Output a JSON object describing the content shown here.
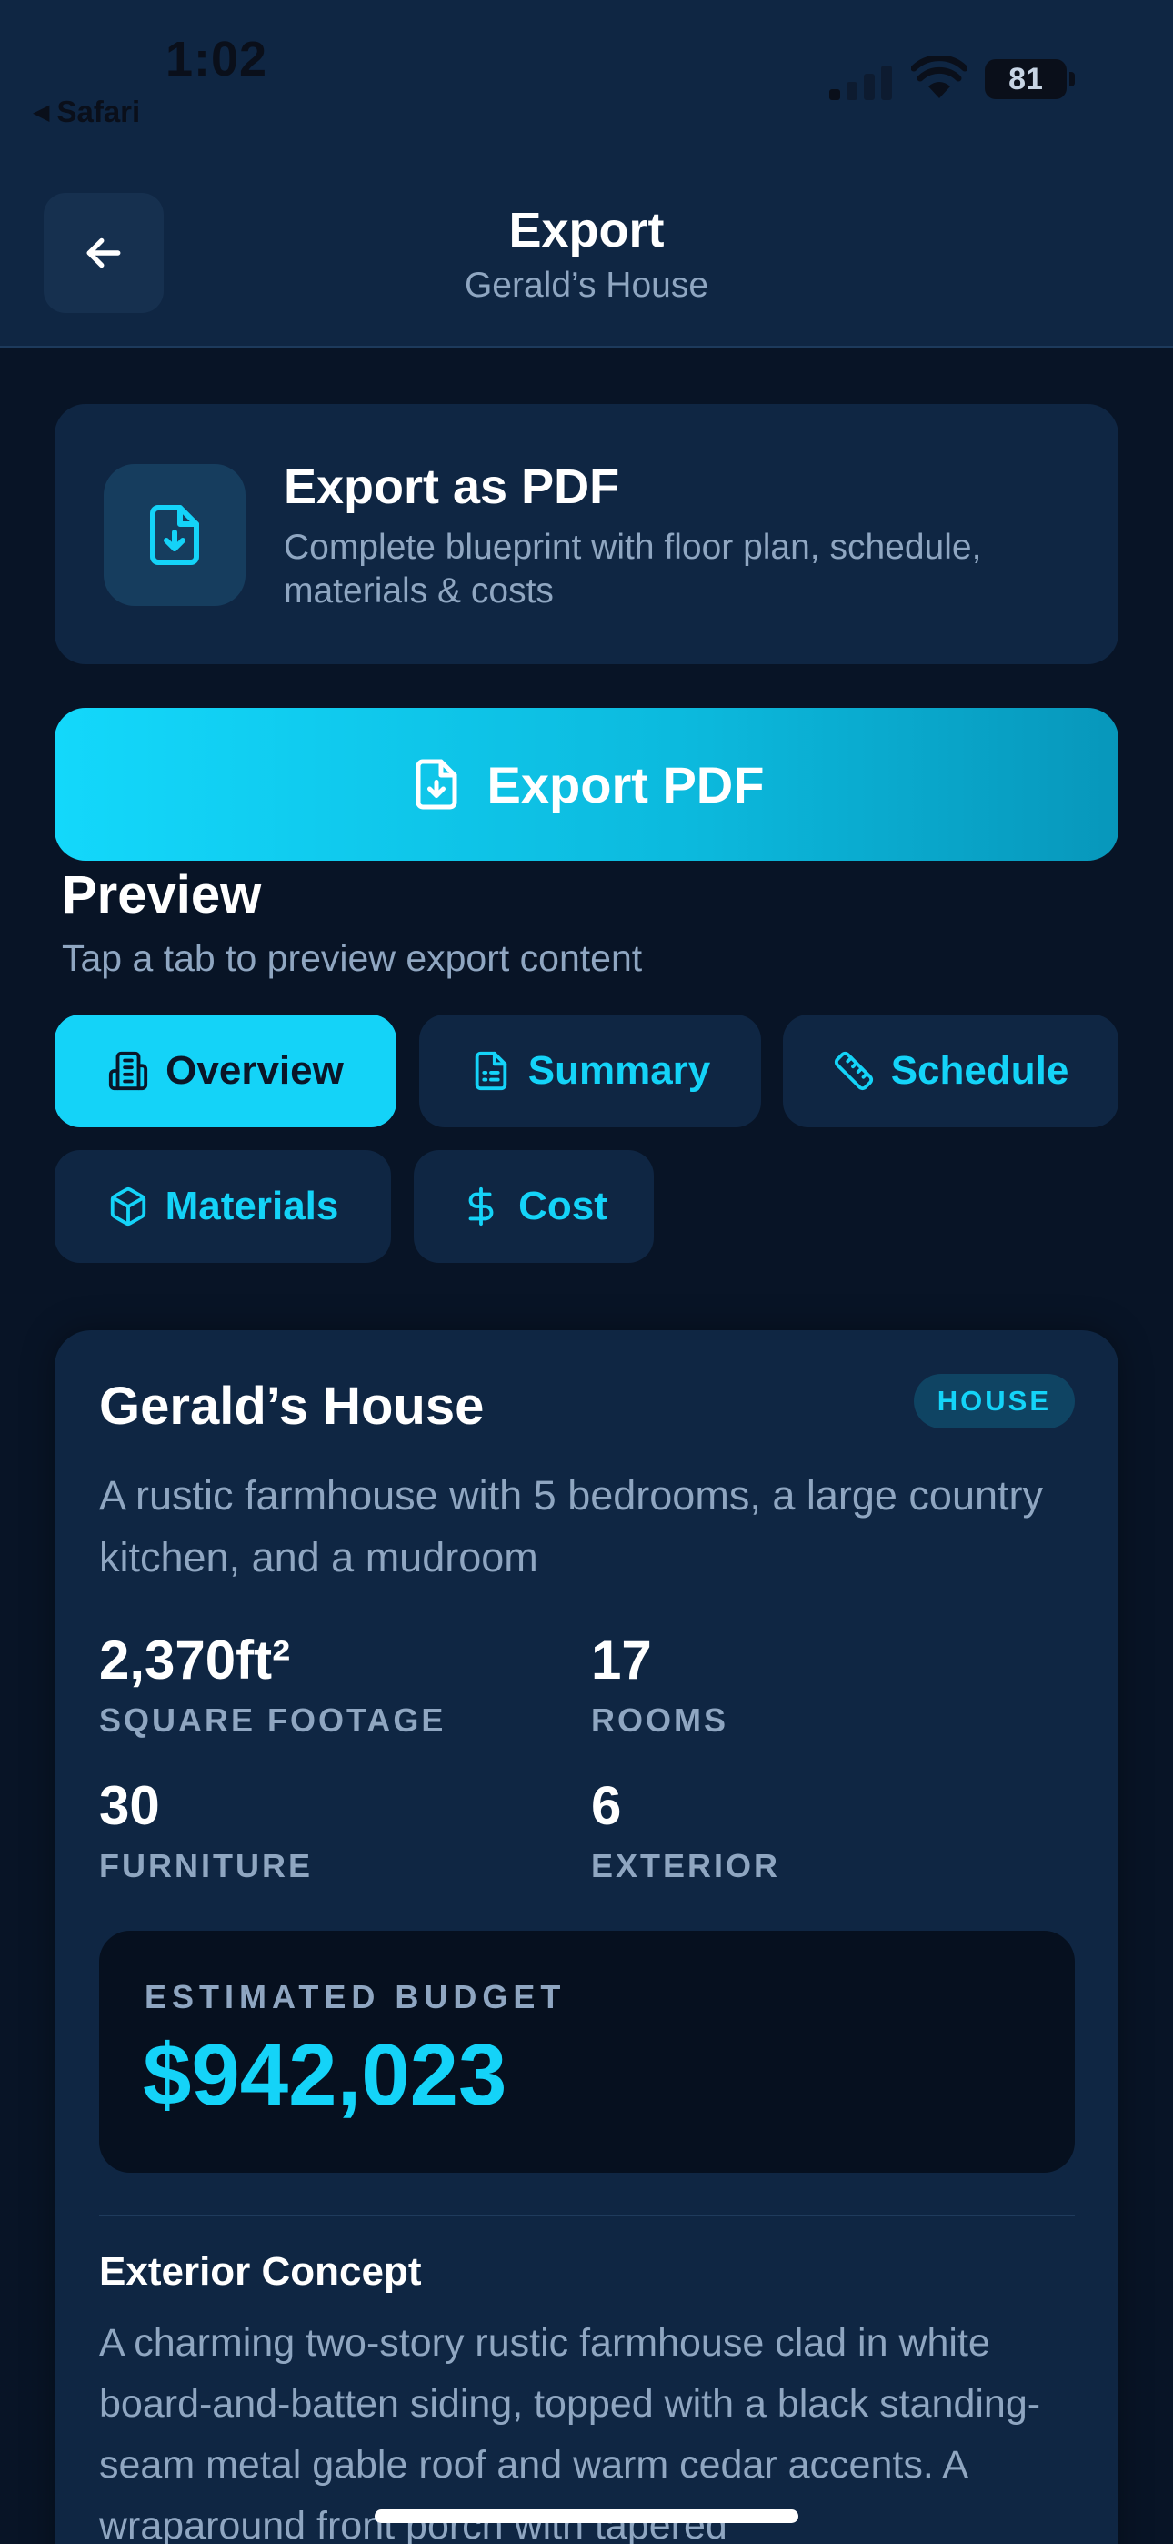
{
  "status_bar": {
    "time": "1:02",
    "back_app": "Safari",
    "battery": "81"
  },
  "header": {
    "title": "Export",
    "subtitle": "Gerald’s House",
    "back_icon": "arrow-left-icon"
  },
  "export_card": {
    "icon": "file-download-icon",
    "title": "Export as PDF",
    "description": "Complete blueprint with floor plan, schedule, materials & costs"
  },
  "export_button": {
    "icon": "file-download-icon",
    "label": "Export PDF"
  },
  "preview": {
    "heading": "Preview",
    "hint": "Tap a tab to preview export content",
    "tabs": [
      {
        "label": "Overview",
        "icon": "building-icon",
        "active": true
      },
      {
        "label": "Summary",
        "icon": "document-list-icon",
        "active": false
      },
      {
        "label": "Schedule",
        "icon": "ruler-icon",
        "active": false
      },
      {
        "label": "Materials",
        "icon": "box-icon",
        "active": false
      },
      {
        "label": "Cost",
        "icon": "dollar-icon",
        "active": false
      }
    ]
  },
  "overview": {
    "project_name": "Gerald’s House",
    "type_badge": "HOUSE",
    "description": "A rustic farmhouse with 5 bedrooms, a large country kitchen, and a mudroom",
    "stats": [
      {
        "value": "2,370ft²",
        "label": "SQUARE FOOTAGE"
      },
      {
        "value": "17",
        "label": "ROOMS"
      },
      {
        "value": "30",
        "label": "FURNITURE"
      },
      {
        "value": "6",
        "label": "EXTERIOR"
      }
    ],
    "budget_label": "ESTIMATED BUDGET",
    "budget_value": "$942,023",
    "section_heading": "Exterior Concept",
    "section_text": "A charming two-story rustic farmhouse clad in white board-and-batten siding, topped with a black standing-seam metal gable roof and warm cedar accents. A wraparound front porch with tapered"
  },
  "colors": {
    "background": "#081426",
    "surface": "#0f2643",
    "accent": "#14d3f8",
    "muted_text": "#8fa6c1"
  }
}
